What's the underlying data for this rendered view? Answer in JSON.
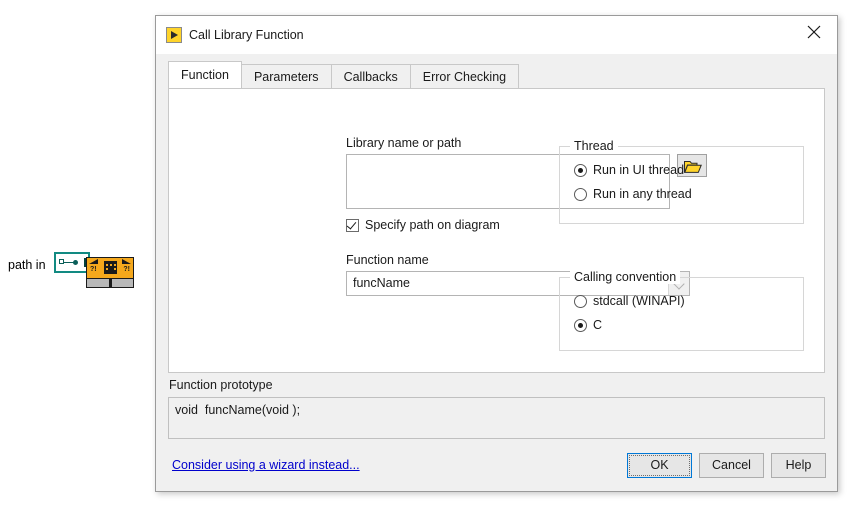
{
  "block_diagram": {
    "path_label": "path in",
    "path_terminal_name": "path-control-terminal",
    "node_name": "call-library-function-node"
  },
  "dialog": {
    "title": "Call Library Function",
    "title_icon": "labview-vi-icon",
    "close_icon": "close-icon"
  },
  "tabs": [
    {
      "label": "Function",
      "active": true
    },
    {
      "label": "Parameters",
      "active": false
    },
    {
      "label": "Callbacks",
      "active": false
    },
    {
      "label": "Error Checking",
      "active": false
    }
  ],
  "function_tab": {
    "library": {
      "label": "Library name or path",
      "value": "",
      "placeholder": "",
      "browse_icon": "folder-open-icon"
    },
    "specify_path_checkbox": {
      "label": "Specify path on diagram",
      "checked": true
    },
    "function_name": {
      "label": "Function name",
      "value": "funcName",
      "dropdown_icon": "chevron-down-icon"
    },
    "thread": {
      "title": "Thread",
      "options": [
        {
          "label": "Run in UI thread",
          "selected": true
        },
        {
          "label": "Run in any thread",
          "selected": false
        }
      ]
    },
    "calling_convention": {
      "title": "Calling convention",
      "options": [
        {
          "label": "stdcall (WINAPI)",
          "selected": false
        },
        {
          "label": "C",
          "selected": true
        }
      ]
    }
  },
  "prototype": {
    "label": "Function prototype",
    "text": "void  funcName(void );"
  },
  "footer": {
    "wizard_link": "Consider using a wizard instead...",
    "ok_label": "OK",
    "cancel_label": "Cancel",
    "help_label": "Help"
  },
  "colors": {
    "accent": "#0078d7",
    "link": "#0000cc",
    "node_orange": "#f5a81c",
    "terminal_teal": "#128a82",
    "icon_yellow": "#ffd42a"
  }
}
